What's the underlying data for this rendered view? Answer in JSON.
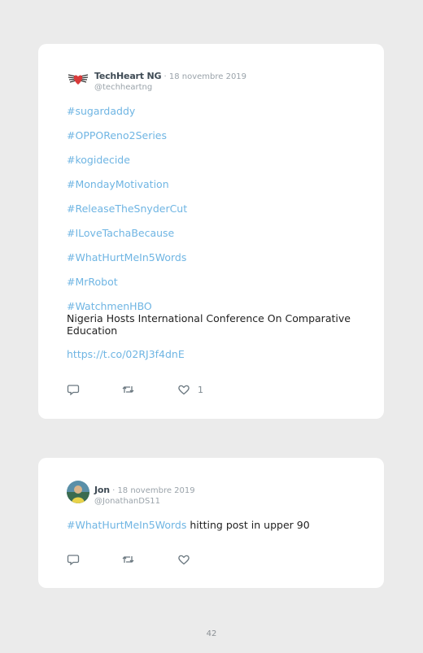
{
  "tweets": [
    {
      "author": "TechHeart NG",
      "date": "18 novembre 2019",
      "handle": "@techheartng",
      "hashtags": [
        "#sugardaddy",
        "#OPPOReno2Series",
        "#kogidecide",
        "#MondayMotivation",
        "#ReleaseTheSnyderCut",
        "#ILoveTachaBecause",
        "#WhatHurtMeIn5Words",
        "#MrRobot",
        "#WatchmenHBO"
      ],
      "text": "Nigeria Hosts International Conference On Comparative Education",
      "link": "https://t.co/02RJ3f4dnE",
      "likes": "1"
    },
    {
      "author": "Jon",
      "date": "18 novembre 2019",
      "handle": "@JonathanDS11",
      "hashtag": "#WhatHurtMeIn5Words",
      "text": " hitting post in upper 90"
    }
  ],
  "separator": " · ",
  "page_number": "42",
  "colors": {
    "link": "#6fb5e3",
    "background": "#ebebeb",
    "card": "#ffffff"
  },
  "icons": [
    "heart-wings-logo-icon",
    "reply-icon",
    "retweet-icon",
    "like-icon"
  ]
}
